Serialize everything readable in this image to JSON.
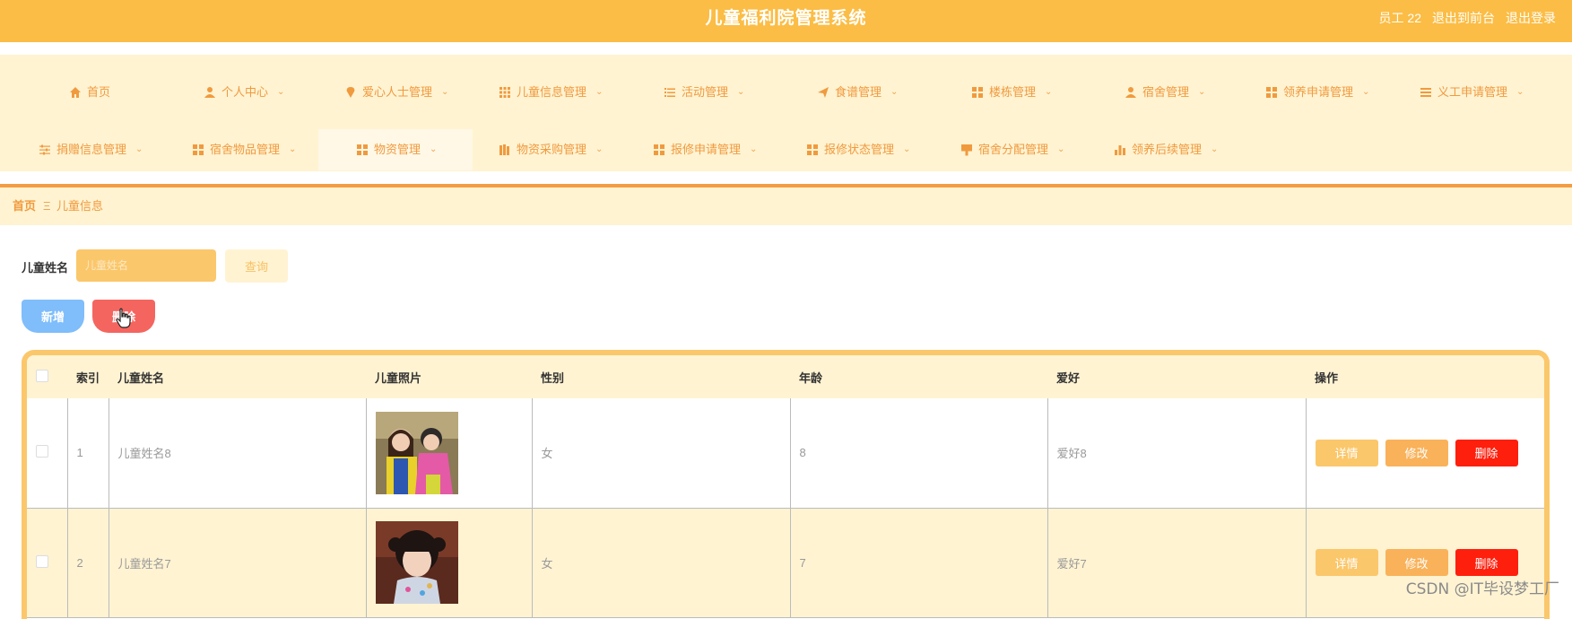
{
  "header": {
    "title": "儿童福利院管理系统",
    "user": "员工 22",
    "to_front": "退出到前台",
    "logout": "退出登录"
  },
  "nav": {
    "row1": [
      {
        "label": "首页",
        "icon": "home-icon"
      },
      {
        "label": "个人中心",
        "icon": "user-icon"
      },
      {
        "label": "爱心人士管理",
        "icon": "location-pin-icon"
      },
      {
        "label": "儿童信息管理",
        "icon": "grid-icon"
      },
      {
        "label": "活动管理",
        "icon": "list-icon"
      },
      {
        "label": "食谱管理",
        "icon": "paper-plane-icon"
      },
      {
        "label": "楼栋管理",
        "icon": "apps-icon"
      },
      {
        "label": "宿舍管理",
        "icon": "user-icon"
      },
      {
        "label": "领养申请管理",
        "icon": "apps-icon"
      },
      {
        "label": "义工申请管理",
        "icon": "menu-icon"
      }
    ],
    "row2": [
      {
        "label": "捐赠信息管理",
        "icon": "sliders-icon"
      },
      {
        "label": "宿舍物品管理",
        "icon": "apps-icon"
      },
      {
        "label": "物资管理",
        "icon": "apps-icon"
      },
      {
        "label": "物资采购管理",
        "icon": "book-icon"
      },
      {
        "label": "报修申请管理",
        "icon": "apps-icon"
      },
      {
        "label": "报修状态管理",
        "icon": "apps-icon"
      },
      {
        "label": "宿舍分配管理",
        "icon": "paint-brush-icon"
      },
      {
        "label": "领养后续管理",
        "icon": "bar-chart-icon"
      }
    ]
  },
  "breadcrumb": {
    "home": "首页",
    "separator": "Ξ",
    "current": "儿童信息"
  },
  "search": {
    "label": "儿童姓名",
    "placeholder": "儿童姓名",
    "query_button": "查询"
  },
  "actions": {
    "add": "新增",
    "delete": "删除"
  },
  "table": {
    "columns": [
      "索引",
      "儿童姓名",
      "儿童照片",
      "性别",
      "年龄",
      "爱好",
      "操作"
    ],
    "rows": [
      {
        "index": "1",
        "name": "儿童姓名8",
        "gender": "女",
        "age": "8",
        "hobby": "爱好8"
      },
      {
        "index": "2",
        "name": "儿童姓名7",
        "gender": "女",
        "age": "7",
        "hobby": "爱好7"
      }
    ],
    "row_actions": {
      "detail": "详情",
      "edit": "修改",
      "remove": "删除"
    }
  },
  "watermark": "CSDN @IT毕设梦工厂",
  "colors": {
    "header_bg": "#fbbd45",
    "nav_bg": "#fff3d2",
    "accent": "#f09a3e",
    "add_button": "#7fbdfb",
    "delete_button": "#f56560",
    "remove_button": "#ff1f0d"
  }
}
